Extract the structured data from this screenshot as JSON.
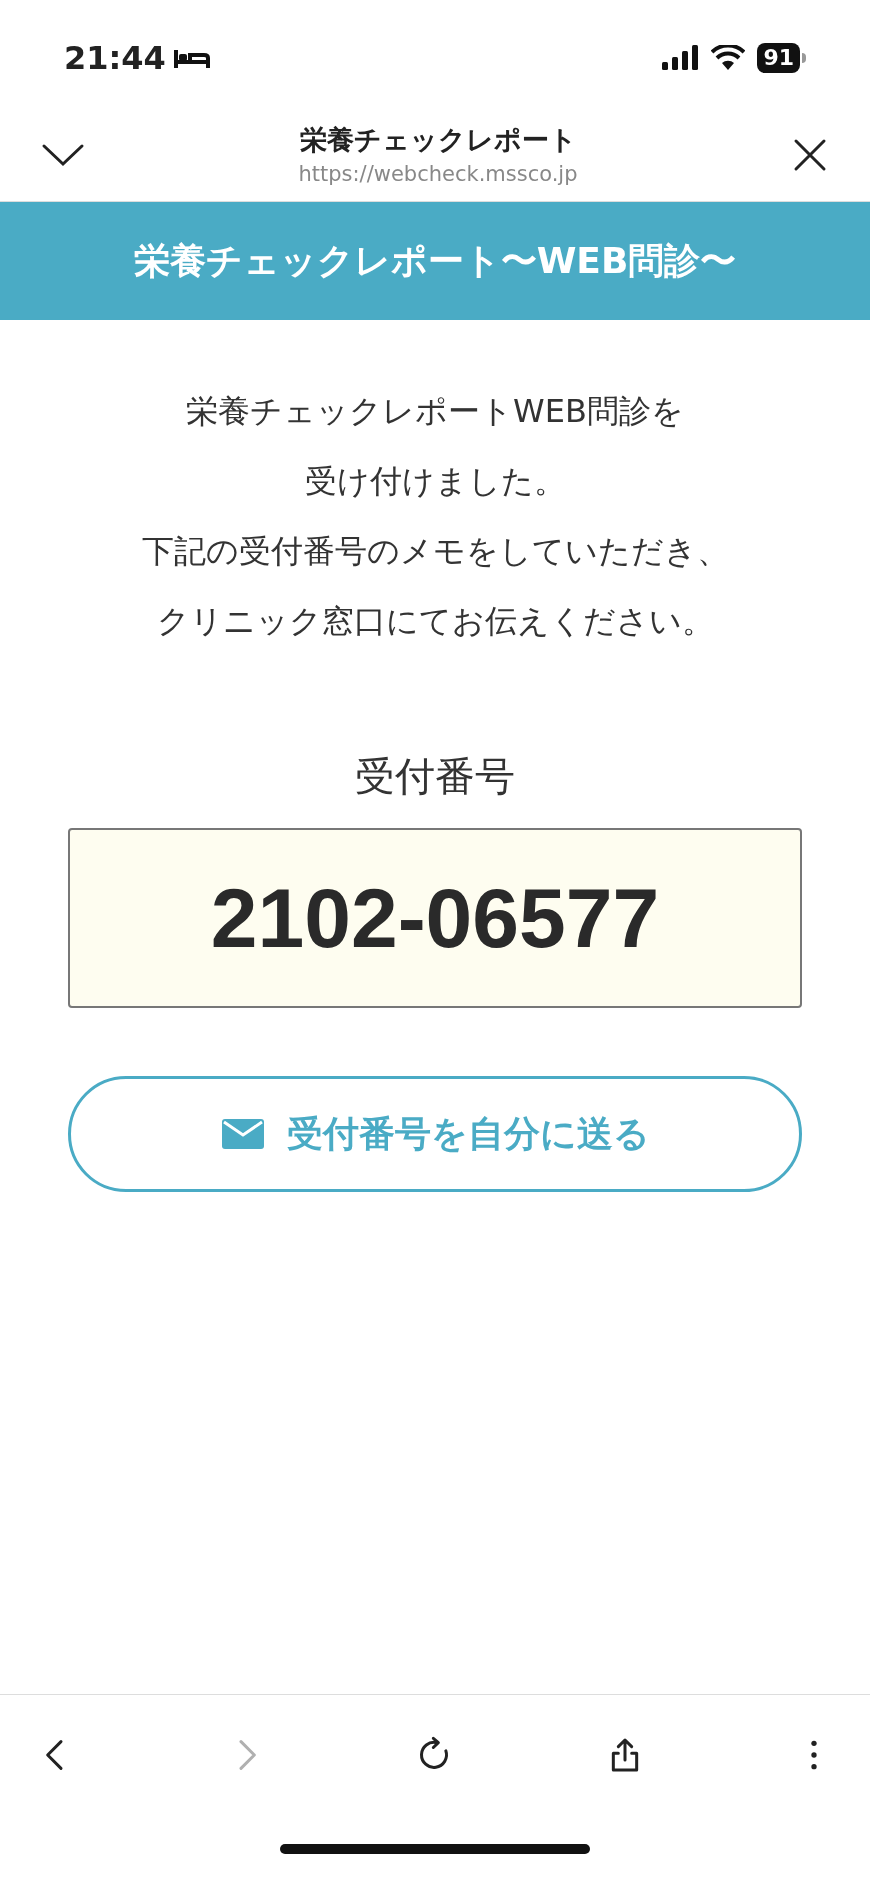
{
  "status_bar": {
    "time": "21:44",
    "battery": "91"
  },
  "browser_header": {
    "title": "栄養チェックレポート",
    "url": "https://webcheck.mssco.jp"
  },
  "banner": {
    "title": "栄養チェックレポート〜WEB問診〜"
  },
  "message": [
    "栄養チェックレポートWEB問診を",
    "受け付けました。",
    "下記の受付番号のメモをしていただき、",
    "クリニック窓口にてお伝えください。"
  ],
  "receipt": {
    "label": "受付番号",
    "number": "2102-06577"
  },
  "send_button": {
    "label": "受付番号を自分に送る"
  },
  "toolbar": [
    {
      "kind": "back",
      "disabled": false
    },
    {
      "kind": "forward",
      "disabled": true
    },
    {
      "kind": "reload",
      "disabled": false
    },
    {
      "kind": "share",
      "disabled": false
    },
    {
      "kind": "more",
      "disabled": false
    }
  ]
}
